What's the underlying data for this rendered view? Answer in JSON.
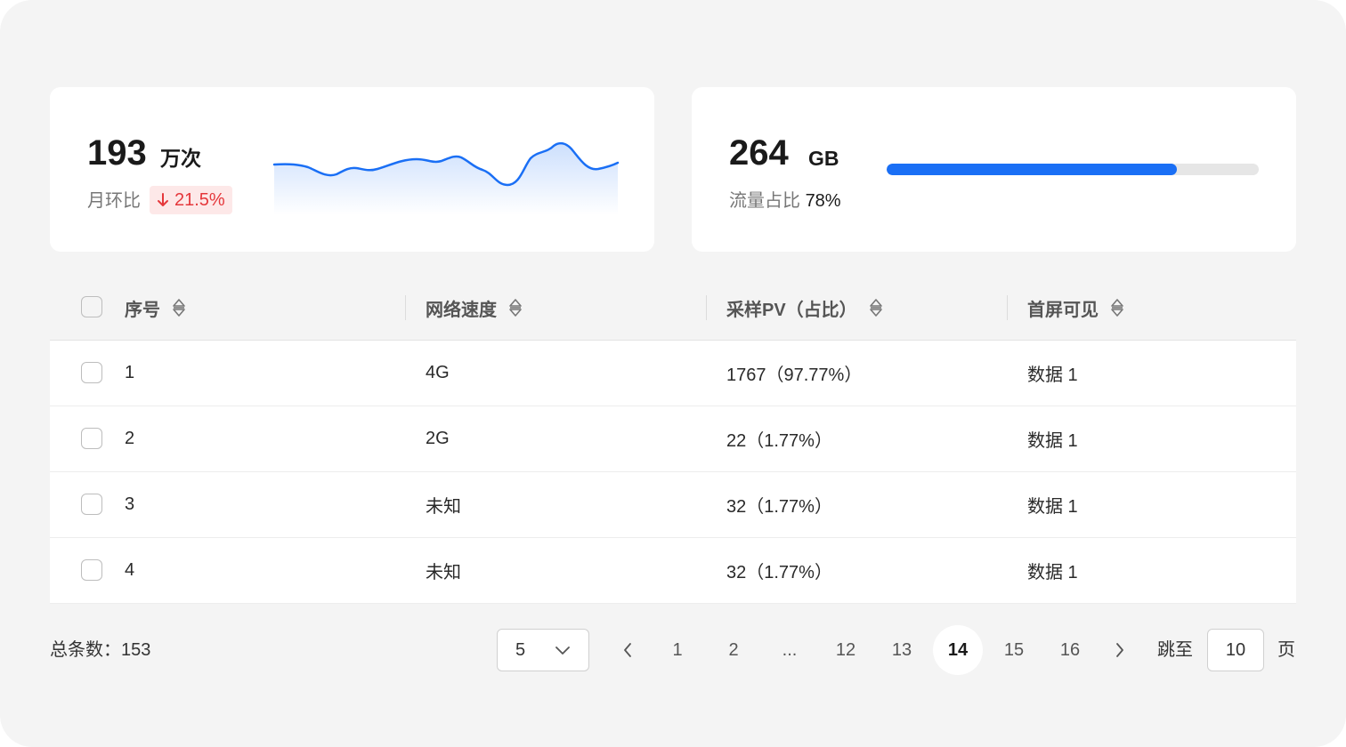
{
  "stats": {
    "visits": {
      "value": "193",
      "unit": "万次",
      "mom_label": "月环比",
      "mom_change": "21.5%",
      "mom_direction": "down",
      "trend_color": "#1a6ff5",
      "change_color": "#e5373b"
    },
    "traffic": {
      "value": "264",
      "unit": "GB",
      "share_label": "流量占比",
      "share_value": "78%",
      "share_fraction": 0.78,
      "bar_color": "#1a6ff5"
    }
  },
  "table": {
    "headers": [
      "序号",
      "网络速度",
      "采样PV（占比）",
      "首屏可见"
    ],
    "rows": [
      [
        "1",
        "4G",
        "1767（97.77%）",
        "数据 1"
      ],
      [
        "2",
        "2G",
        "22（1.77%）",
        "数据 1"
      ],
      [
        "3",
        "未知",
        "32（1.77%）",
        "数据 1"
      ],
      [
        "4",
        "未知",
        "32（1.77%）",
        "数据 1"
      ]
    ]
  },
  "pagination": {
    "total_label": "总条数：153",
    "page_size": "5",
    "pages": [
      "1",
      "2",
      "...",
      "12",
      "13",
      "14",
      "15",
      "16"
    ],
    "current_page": "14",
    "jump_label": "跳至",
    "jump_value": "10",
    "page_suffix": "页"
  }
}
